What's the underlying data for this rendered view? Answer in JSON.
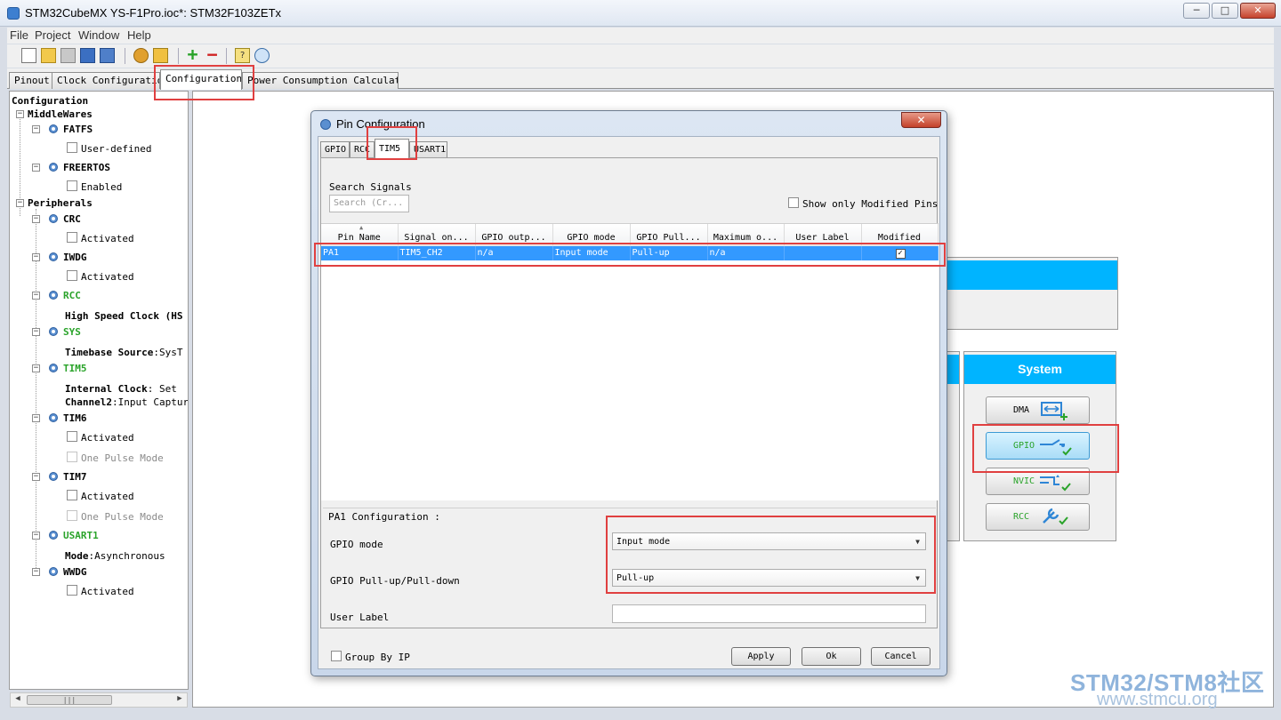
{
  "window": {
    "title": "STM32CubeMX YS-F1Pro.ioc*: STM32F103ZETx",
    "controls": [
      "─",
      "□",
      "✕"
    ]
  },
  "menu": [
    "File",
    "Project",
    "Window",
    "Help"
  ],
  "main_tabs": [
    "Pinout",
    "Clock Configuration",
    "Configuration",
    "Power Consumption Calculator"
  ],
  "tree": {
    "root": "Configuration",
    "middlewares": "MiddleWares",
    "fatfs": "FATFS",
    "fatfs_option": "User-defined",
    "freertos": "FREERTOS",
    "freertos_option": "Enabled",
    "peripherals": "Peripherals",
    "crc": "CRC",
    "crc_option": "Activated",
    "iwdg": "IWDG",
    "iwdg_option": "Activated",
    "rcc": "RCC",
    "rcc_detail_key": "High Speed Clock (HS",
    "sys": "SYS",
    "sys_detail_key": "Timebase Source",
    "sys_detail_val": ":SysT",
    "tim5": "TIM5",
    "tim5_detail1_key": "Internal Clock",
    "tim5_detail1_val": ": Set",
    "tim5_detail2_key": "Channel2",
    "tim5_detail2_val": ":Input Capture",
    "tim6": "TIM6",
    "tim6_opt1": "Activated",
    "tim6_opt2": "One Pulse Mode",
    "tim7": "TIM7",
    "tim7_opt1": "Activated",
    "tim7_opt2": "One Pulse Mode",
    "usart1": "USART1",
    "usart1_detail_key": "Mode",
    "usart1_detail_val": ":Asynchronous",
    "wwdg": "WWDG",
    "wwdg_option": "Activated"
  },
  "system_panel": {
    "title": "System",
    "buttons": [
      "DMA",
      "GPIO",
      "NVIC",
      "RCC"
    ]
  },
  "dialog": {
    "title": "Pin Configuration",
    "close": "✕",
    "tabs": [
      "GPIO",
      "RCC",
      "TIM5",
      "USART1"
    ],
    "search_label": "Search Signals",
    "search_placeholder": "Search (Cr...",
    "show_modified": "Show only Modified Pins",
    "columns": [
      "Pin Name",
      "Signal on...",
      "GPIO outp...",
      "GPIO mode",
      "GPIO Pull...",
      "Maximum o...",
      "User Label",
      "Modified"
    ],
    "rows": [
      [
        "PA1",
        "TIM5_CH2",
        "n/a",
        "Input mode",
        "Pull-up",
        "n/a",
        "",
        "✓"
      ]
    ],
    "config_title": "PA1 Configuration :",
    "gpio_mode_label": "GPIO mode",
    "gpio_mode_value": "Input mode",
    "pull_label": "GPIO Pull-up/Pull-down",
    "pull_value": "Pull-up",
    "user_label_label": "User Label",
    "user_label_value": "",
    "group_by_ip": "Group By IP",
    "apply": "Apply",
    "ok": "Ok",
    "cancel": "Cancel"
  },
  "watermark": {
    "line1": "STM32/STM8社区",
    "line2": "www.stmcu.org"
  },
  "colors": {
    "accent": "#00b4ff",
    "selection": "#3399ff",
    "highlight_red": "#e04040",
    "active_green": "#2aa32a"
  }
}
